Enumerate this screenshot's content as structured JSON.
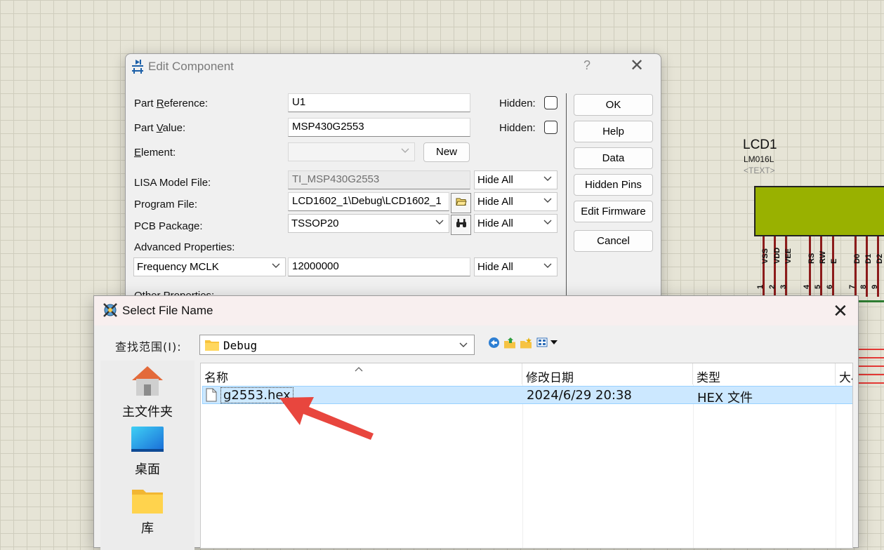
{
  "schematic": {
    "lcd_ref": "LCD1",
    "lcd_model": "LM016L",
    "lcd_text": "<TEXT>",
    "pins": [
      {
        "name": "VSS",
        "num": "1"
      },
      {
        "name": "VDD",
        "num": "2"
      },
      {
        "name": "VEE",
        "num": "3"
      },
      {
        "name": "RS",
        "num": "4"
      },
      {
        "name": "RW",
        "num": "5"
      },
      {
        "name": "E",
        "num": "6"
      },
      {
        "name": "D0",
        "num": "7"
      },
      {
        "name": "D1",
        "num": "8"
      },
      {
        "name": "D2",
        "num": "9"
      }
    ],
    "colors": {
      "lcd_body": "#99b100",
      "pin": "#8c1b1b",
      "bus": "#2e7d32",
      "wire": "#e53935"
    }
  },
  "edit_component": {
    "title": "Edit Component",
    "help_glyph": "?",
    "close_glyph": "✕",
    "part_reference": {
      "label_pre": "Part ",
      "label_key": "R",
      "label_post": "eference:",
      "value": "U1",
      "hidden_label": "Hidden:"
    },
    "part_value": {
      "label_pre": "Part ",
      "label_key": "V",
      "label_post": "alue:",
      "value": "MSP430G2553",
      "hidden_label": "Hidden:"
    },
    "element": {
      "label_key": "E",
      "label_post": "lement:",
      "value": "",
      "new_label": "New"
    },
    "lisa_model": {
      "label": "LISA Model File:",
      "value": "TI_MSP430G2553",
      "visibility": "Hide All"
    },
    "program_file": {
      "label": "Program File:",
      "value": "LCD1602_1\\Debug\\LCD1602_1",
      "visibility": "Hide All"
    },
    "pcb_package": {
      "label": "PCB Package:",
      "value": "TSSOP20",
      "visibility": "Hide All"
    },
    "advanced": {
      "label": "Advanced Properties:",
      "property": "Frequency MCLK",
      "value": "12000000",
      "visibility": "Hide All"
    },
    "other_properties_label": "Other Properties:",
    "buttons": {
      "ok": "OK",
      "help": "Help",
      "data": "Data",
      "hidden_pins": "Hidden Pins",
      "edit_firmware": "Edit Firmware",
      "cancel": "Cancel"
    }
  },
  "select_file": {
    "title": "Select File Name",
    "close_glyph": "✕",
    "look_in_label": "查找范围(I):",
    "look_in_value": "Debug",
    "places": [
      {
        "label": "主文件夹",
        "icon": "home-icon"
      },
      {
        "label": "桌面",
        "icon": "desktop-icon"
      },
      {
        "label": "库",
        "icon": "library-folder-icon"
      }
    ],
    "columns": [
      "名称",
      "修改日期",
      "类型",
      "大小"
    ],
    "files": [
      {
        "name": "g2553.hex",
        "modified": "2024/6/29 20:38",
        "type": "HEX 文件"
      }
    ],
    "colors": {
      "selection": "#cce8ff",
      "annotation_arrow": "#e8463e"
    }
  }
}
